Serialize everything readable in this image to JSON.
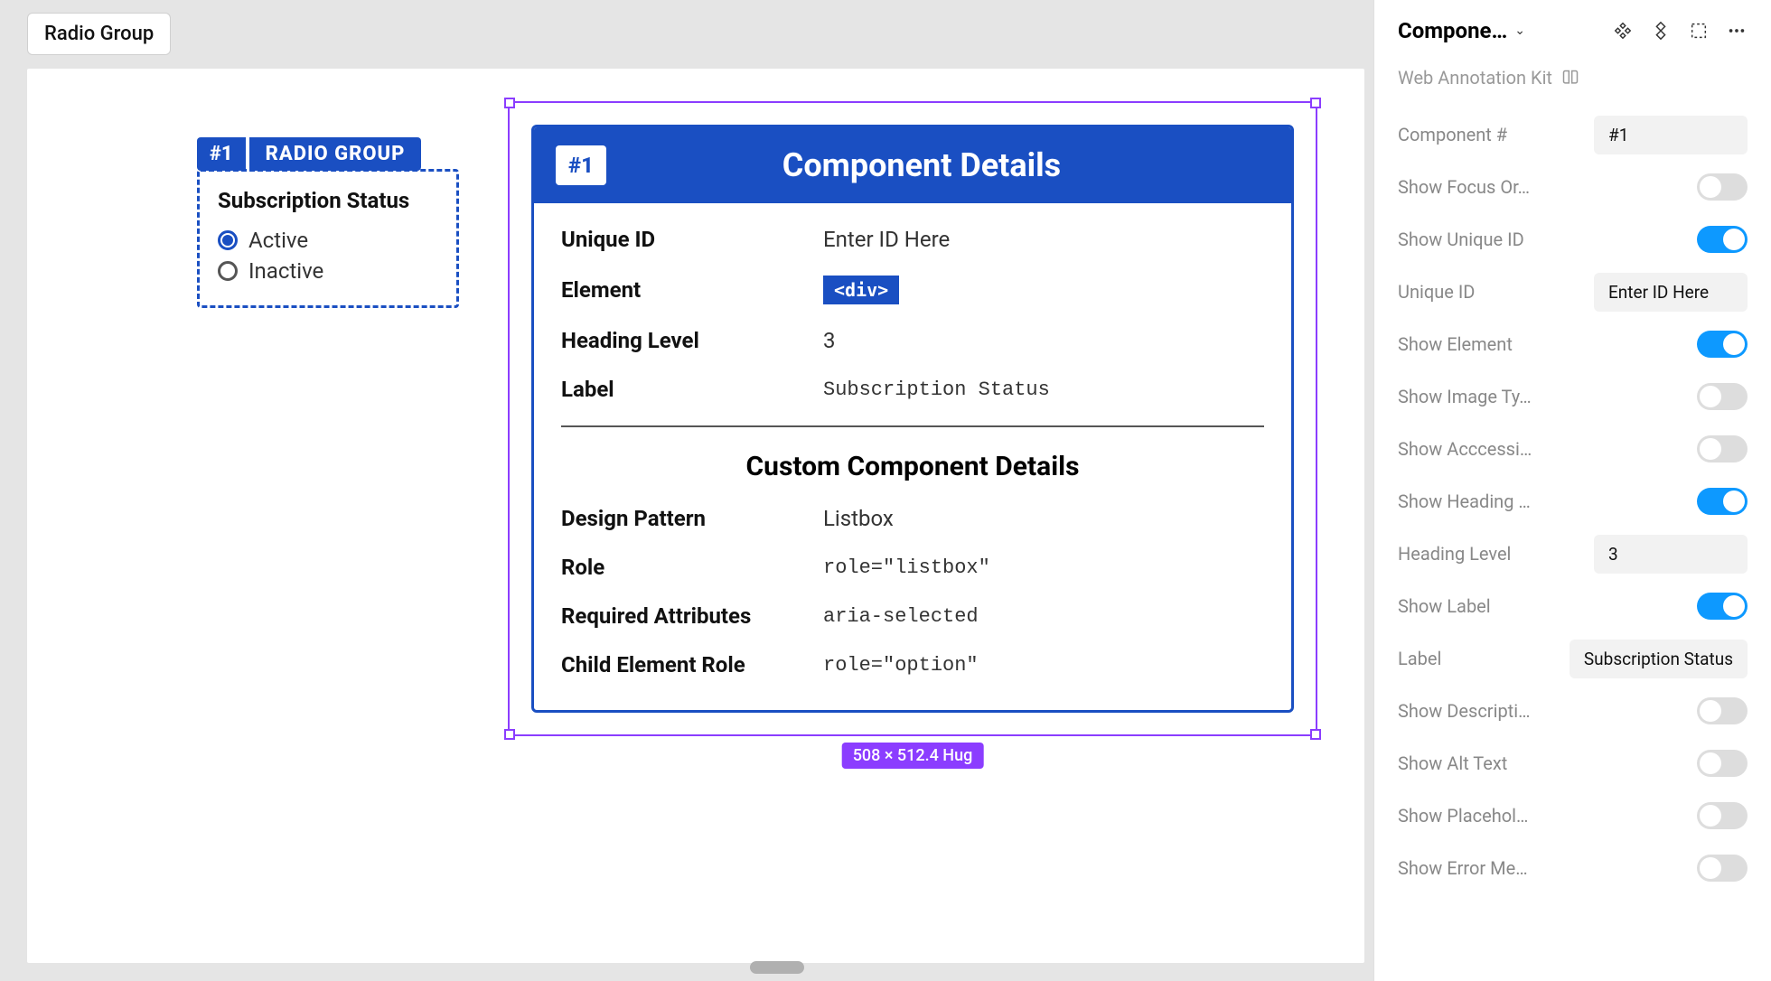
{
  "topTab": "Radio Group",
  "radioAnnot": {
    "badge": "#1",
    "title": "RADIO GROUP",
    "groupLabel": "Subscription Status",
    "options": [
      "Active",
      "Inactive"
    ]
  },
  "details": {
    "badge": "#1",
    "title": "Component Details",
    "rows": {
      "uniqueId": {
        "label": "Unique ID",
        "value": "Enter ID Here"
      },
      "element": {
        "label": "Element",
        "value": "<div>"
      },
      "headingLevel": {
        "label": "Heading Level",
        "value": "3"
      },
      "label": {
        "label": "Label",
        "value": "Subscription Status"
      }
    },
    "subheader": "Custom Component Details",
    "customRows": {
      "designPattern": {
        "label": "Design Pattern",
        "value": "Listbox"
      },
      "role": {
        "label": "Role",
        "value": "role=\"listbox\""
      },
      "requiredAttrs": {
        "label": "Required Attributes",
        "value": "aria-selected"
      },
      "childRole": {
        "label": "Child Element Role",
        "value": "role=\"option\""
      }
    },
    "sizeLabel": "508 × 512.4 Hug"
  },
  "props": {
    "title": "Compone…",
    "kit": "Web Annotation Kit",
    "rows": [
      {
        "label": "Component #",
        "type": "pill",
        "value": "#1"
      },
      {
        "label": "Show Focus Or…",
        "type": "toggle",
        "on": false
      },
      {
        "label": "Show Unique ID",
        "type": "toggle",
        "on": true
      },
      {
        "label": "Unique ID",
        "type": "pill",
        "value": "Enter ID Here"
      },
      {
        "label": "Show Element",
        "type": "toggle",
        "on": true
      },
      {
        "label": "Show Image Ty…",
        "type": "toggle",
        "on": false
      },
      {
        "label": "Show Acccessi…",
        "type": "toggle",
        "on": false
      },
      {
        "label": "Show Heading …",
        "type": "toggle",
        "on": true
      },
      {
        "label": "Heading Level",
        "type": "pill",
        "value": "3"
      },
      {
        "label": "Show Label",
        "type": "toggle",
        "on": true
      },
      {
        "label": "Label",
        "type": "pill",
        "value": "Subscription Status"
      },
      {
        "label": "Show Descripti…",
        "type": "toggle",
        "on": false
      },
      {
        "label": "Show Alt Text",
        "type": "toggle",
        "on": false
      },
      {
        "label": "Show Placehol…",
        "type": "toggle",
        "on": false
      },
      {
        "label": "Show Error Me…",
        "type": "toggle",
        "on": false
      }
    ]
  }
}
